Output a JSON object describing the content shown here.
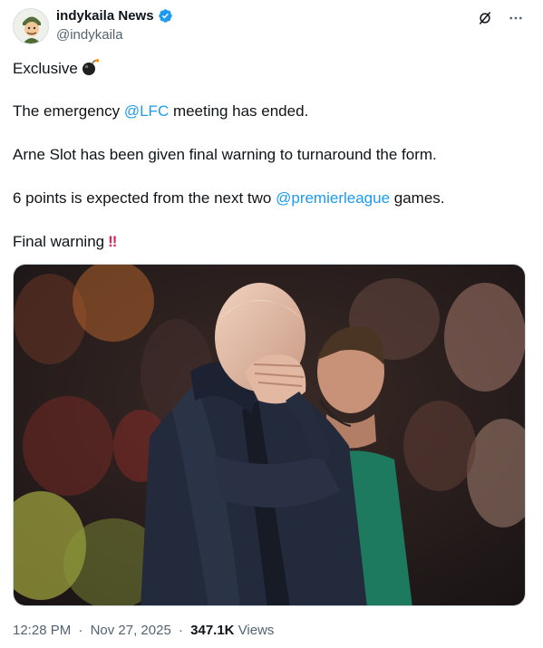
{
  "author": {
    "display_name": "indykaila News",
    "handle": "@indykaila",
    "verified_color": "#1d9bf0"
  },
  "icons": {
    "grok": "grok-icon",
    "more": "more-options-icon",
    "verified": "verified-badge-icon",
    "bomb": "bomb-emoji-icon"
  },
  "tweet": {
    "line1_text": "Exclusive",
    "line2_prefix": "The emergency ",
    "line2_mention": "@LFC",
    "line2_suffix": " meeting has ended.",
    "line3_text": "Arne Slot has been given final warning to turnaround the form.",
    "line4_prefix": "6 points is expected from the next two ",
    "line4_mention": "@premierleague",
    "line4_suffix": " games.",
    "line5_text": "Final warning",
    "line5_emoji": "!!"
  },
  "meta": {
    "time": "12:28 PM",
    "dot": "·",
    "date": "Nov 27, 2025",
    "views_count": "347.1K",
    "views_label": "Views"
  },
  "colors": {
    "text": "#0f1419",
    "secondary": "#536471",
    "link": "#1d9bf0",
    "border": "#cfd9de"
  }
}
